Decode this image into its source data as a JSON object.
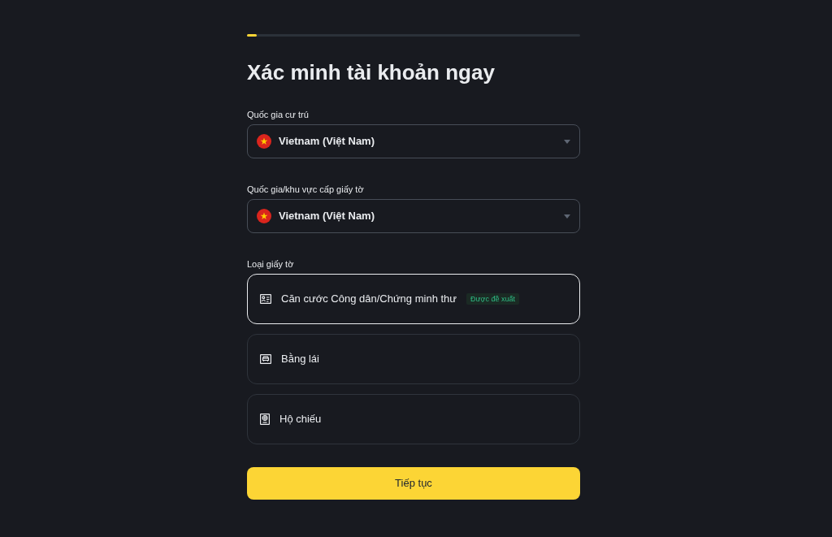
{
  "progress": {
    "level": 0.03
  },
  "title": "Xác minh tài khoản ngay",
  "fields": [
    {
      "label": "Quốc gia cư trú",
      "value": "Vietnam (Việt Nam)"
    },
    {
      "label": "Quốc gia/khu vực cấp giấy tờ",
      "value": "Vietnam (Việt Nam)"
    }
  ],
  "document_type": {
    "label": "Loại giấy tờ",
    "options": [
      {
        "kind": "id-card",
        "label": "Căn cước Công dân/Chứng minh thư",
        "badge": "Được đề xuất",
        "selected": true
      },
      {
        "kind": "license",
        "label": "Bằng lái",
        "selected": false
      },
      {
        "kind": "passport",
        "label": "Hộ chiếu",
        "selected": false
      }
    ]
  },
  "continue_button": "Tiếp tục"
}
